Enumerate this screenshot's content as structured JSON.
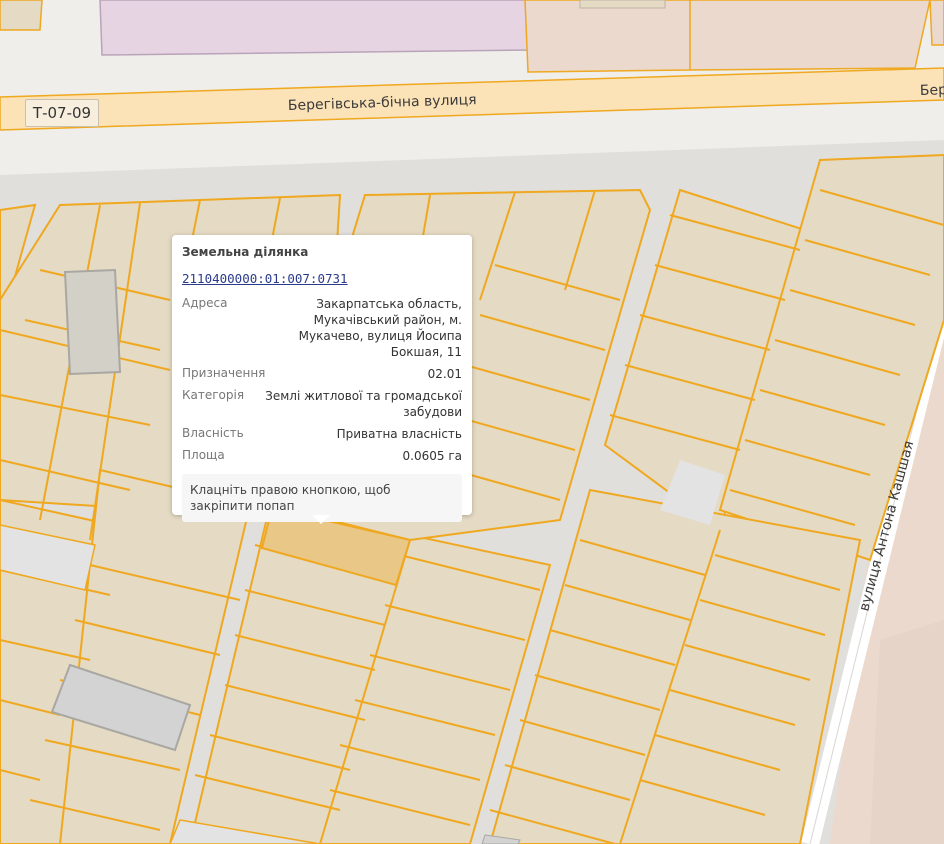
{
  "map": {
    "roads": [
      {
        "name": "Берегівська-бічна вулиця"
      },
      {
        "name": "Бер"
      },
      {
        "name": "вулиця Антона Кашшая"
      }
    ],
    "road_badge": "Т-07-09",
    "colors": {
      "background": "#efeeea",
      "parcel_fill": "#e5dac3",
      "parcel_stroke": "#efa81f",
      "highlight": "#e8c787",
      "road_fill": "#fbe2b7",
      "gray_block": "#d3d3d3",
      "pink_area": "#e6d4e3",
      "salmon_area": "#ecd9cd"
    }
  },
  "popup": {
    "title": "Земельна ділянка",
    "cadastral_number": "2110400000:01:007:0731",
    "fields": [
      {
        "key": "Адреса",
        "value": "Закарпатська область, Мукачівський район, м. Мукачево, вулиця Йосипа Бокшая, 11"
      },
      {
        "key": "Призначення",
        "value": "02.01"
      },
      {
        "key": "Категорія",
        "value": "Землі житлової та громадської забудови"
      },
      {
        "key": "Власність",
        "value": "Приватна власність"
      },
      {
        "key": "Площа",
        "value": "0.0605 га"
      }
    ],
    "hint": "Клацніть правою кнопкою, щоб закріпити попап"
  }
}
